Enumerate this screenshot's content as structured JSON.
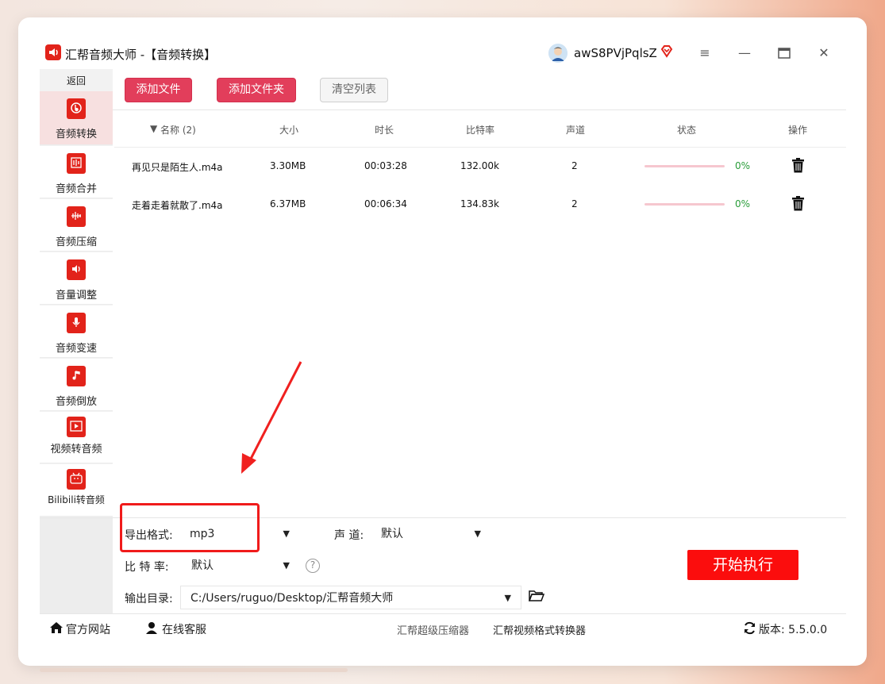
{
  "window": {
    "title": "汇帮音频大师  -【音频转换】",
    "user": "awS8PVjPqlsZ"
  },
  "sidebar": {
    "back": "返回",
    "items": [
      {
        "label": "音频转换",
        "icon": "audio-convert-icon",
        "active": true
      },
      {
        "label": "音频合并",
        "icon": "audio-merge-icon"
      },
      {
        "label": "音频压缩",
        "icon": "audio-compress-icon"
      },
      {
        "label": "音量调整",
        "icon": "volume-adjust-icon"
      },
      {
        "label": "音频变速",
        "icon": "audio-speed-icon"
      },
      {
        "label": "音频倒放",
        "icon": "audio-reverse-icon"
      },
      {
        "label": "视频转音频",
        "icon": "video-to-audio-icon"
      },
      {
        "label": "Bilibili转音频",
        "icon": "bilibili-icon"
      }
    ]
  },
  "toolbar": {
    "add_file": "添加文件",
    "add_folder": "添加文件夹",
    "clear_list": "清空列表"
  },
  "table": {
    "headers": {
      "name": "名称 (2)",
      "size": "大小",
      "duration": "时长",
      "bitrate": "比特率",
      "channels": "声道",
      "status": "状态",
      "action": "操作"
    },
    "rows": [
      {
        "name": "再见只是陌生人.m4a",
        "size": "3.30MB",
        "duration": "00:03:28",
        "bitrate": "132.00k",
        "channels": "2",
        "progress": 0,
        "pct": "0%"
      },
      {
        "name": "走着走着就散了.m4a",
        "size": "6.37MB",
        "duration": "00:06:34",
        "bitrate": "134.83k",
        "channels": "2",
        "progress": 0,
        "pct": "0%"
      }
    ]
  },
  "settings": {
    "format_label": "导出格式:",
    "format_value": "mp3",
    "channel_label": "声  道:",
    "channel_value": "默认",
    "bitrate_label": "比 特 率:",
    "bitrate_value": "默认",
    "output_label": "输出目录:",
    "output_value": "C:/Users/ruguo/Desktop/汇帮音频大师",
    "start": "开始执行",
    "help": "?"
  },
  "footer": {
    "website": "官方网站",
    "support": "在线客服",
    "link1": "汇帮超级压缩器",
    "link2": "汇帮视频格式转换器",
    "version": "版本:  5.5.0.0"
  },
  "colors": {
    "accent": "#e23e5b",
    "brand_red": "#e2231a",
    "start_btn": "#fb0d0d",
    "success": "#2a9d3a"
  }
}
